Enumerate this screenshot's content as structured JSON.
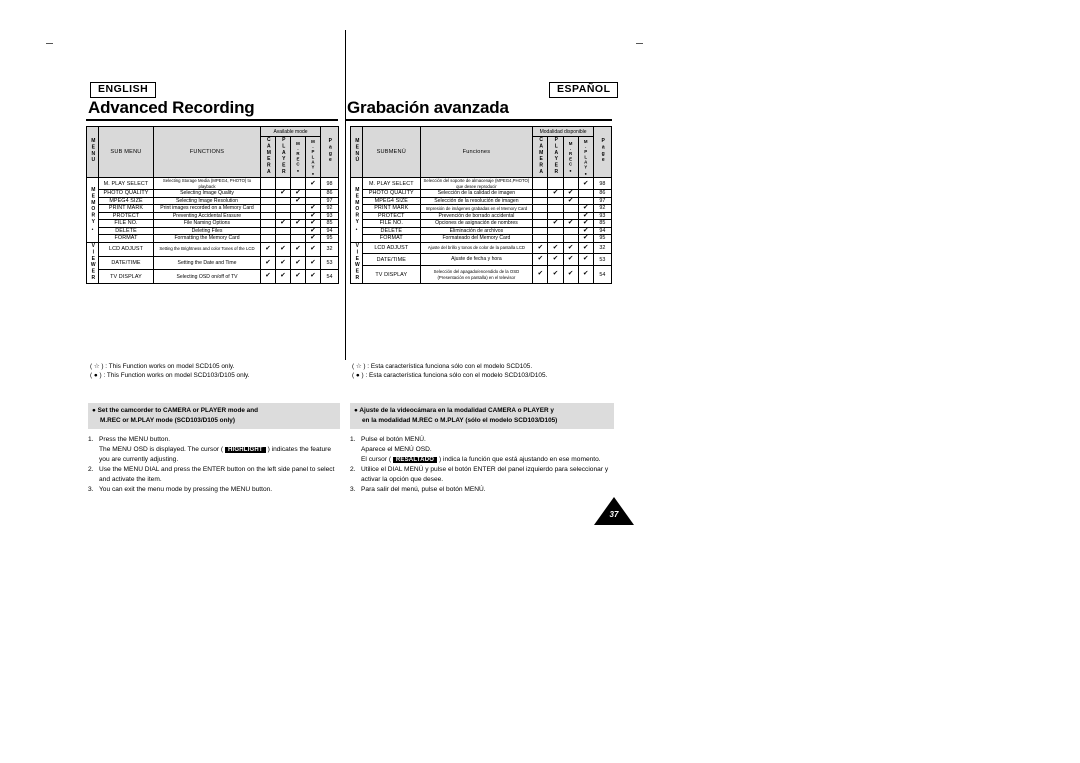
{
  "document": {
    "page_number": "37"
  },
  "english": {
    "language_badge": "ENGLISH",
    "heading": "Advanced Recording",
    "table": {
      "headers": {
        "menu": "MENU",
        "sub_menu": "SUB MENU",
        "functions": "FUNCTIONS",
        "available_mode": "Available mode",
        "camera": "CAMERA",
        "player": "PLAYER",
        "mrec": "M.REC",
        "mplay": "M.PLAY",
        "page": "Page"
      },
      "groups": [
        {
          "label": "MEMORY",
          "symbol": "•",
          "rows": [
            0,
            1,
            2,
            3,
            4,
            5,
            6,
            7
          ]
        },
        {
          "label": "VIEWER",
          "symbol": "",
          "rows": [
            8,
            9,
            10
          ]
        }
      ],
      "rows": [
        {
          "sub_menu": "M. PLAY SELECT",
          "function": "Selecting Storage Media (MPEG4, PHOTO) to playback",
          "camera": "",
          "player": "",
          "mrec": "",
          "mplay": "✔",
          "page": "98"
        },
        {
          "sub_menu": "PHOTO QUALITY",
          "function": "Selecting Image Quality",
          "camera": "",
          "player": "✔",
          "mrec": "✔",
          "mplay": "",
          "page": "86"
        },
        {
          "sub_menu": "MPEG4 SIZE",
          "function": "Selecting Image Resolution",
          "camera": "",
          "player": "",
          "mrec": "✔",
          "mplay": "",
          "page": "97"
        },
        {
          "sub_menu": "PRINT MARK",
          "function": "Print images recorded on a Memory Card",
          "camera": "",
          "player": "",
          "mrec": "",
          "mplay": "✔",
          "page": "92"
        },
        {
          "sub_menu": "PROTECT",
          "function": "Preventing Accidental Erasure",
          "camera": "",
          "player": "",
          "mrec": "",
          "mplay": "✔",
          "page": "93"
        },
        {
          "sub_menu": "FILE NO.",
          "function": "File Naming Options",
          "camera": "",
          "player": "✔",
          "mrec": "✔",
          "mplay": "✔",
          "page": "85"
        },
        {
          "sub_menu": "DELETE",
          "function": "Deleting Files",
          "camera": "",
          "player": "",
          "mrec": "",
          "mplay": "✔",
          "page": "94"
        },
        {
          "sub_menu": "FORMAT",
          "function": "Formatting the Memory Card",
          "camera": "",
          "player": "",
          "mrec": "",
          "mplay": "✔",
          "page": "95"
        },
        {
          "sub_menu": "LCD ADJUST",
          "function": "Setting the Brightness and color Tones of the LCD",
          "camera": "✔",
          "player": "✔",
          "mrec": "✔",
          "mplay": "✔",
          "page": "32"
        },
        {
          "sub_menu": "DATE/TIME",
          "function": "Setting the Date and Time",
          "camera": "✔",
          "player": "✔",
          "mrec": "✔",
          "mplay": "✔",
          "page": "53"
        },
        {
          "sub_menu": "TV DISPLAY",
          "function": "Selecting OSD on/off of TV",
          "camera": "✔",
          "player": "✔",
          "mrec": "✔",
          "mplay": "✔",
          "page": "54"
        }
      ]
    },
    "legend": [
      "( ☆ ) : This Function works on model SCD105 only.",
      "( ● ) : This Function works on model SCD103/D105 only."
    ],
    "callout": {
      "bullet": "●",
      "line1": "Set the camcorder to CAMERA or PLAYER mode and",
      "line2": "M.REC or M.PLAY mode (SCD103/D105 only)"
    },
    "steps": [
      {
        "num": "1.",
        "text_before": "Press the MENU button.\nThe MENU OSD is displayed. The cursor ( ",
        "highlight": "HIGHLIGHT",
        "text_after": " ) indicates the feature you are currently adjusting."
      },
      {
        "num": "2.",
        "text_before": "Use the MENU DIAL and press the ENTER button on the left side panel to select and activate the item.",
        "highlight": "",
        "text_after": ""
      },
      {
        "num": "3.",
        "text_before": "You can exit the menu mode by pressing the MENU button.",
        "highlight": "",
        "text_after": ""
      }
    ]
  },
  "spanish": {
    "language_badge": "ESPAÑOL",
    "heading": "Grabación avanzada",
    "table": {
      "headers": {
        "menu": "MENÚ",
        "sub_menu": "SUBMENÚ",
        "functions": "Funciones",
        "available_mode": "Modalidad disponible",
        "camera": "CAMERA",
        "player": "PLAYER",
        "mrec": "M.REC",
        "mplay": "M.PLAY",
        "page": "Page"
      },
      "groups": [
        {
          "label": "MEMORY",
          "symbol": "•",
          "rows": [
            0,
            1,
            2,
            3,
            4,
            5,
            6,
            7
          ]
        },
        {
          "label": "VIEWER",
          "symbol": "",
          "rows": [
            8,
            9,
            10
          ]
        }
      ],
      "rows": [
        {
          "sub_menu": "M. PLAY SELECT",
          "function": "Selección del soporte de almacenaje (MPEG4,PHOTO) que desee reproducir",
          "camera": "",
          "player": "",
          "mrec": "",
          "mplay": "✔",
          "page": "98"
        },
        {
          "sub_menu": "PHOTO QUALITY",
          "function": "Selección de la calidad de imagen",
          "camera": "",
          "player": "✔",
          "mrec": "✔",
          "mplay": "",
          "page": "86"
        },
        {
          "sub_menu": "MPEG4 SIZE",
          "function": "Selección de la resolución de imagen",
          "camera": "",
          "player": "",
          "mrec": "✔",
          "mplay": "",
          "page": "97"
        },
        {
          "sub_menu": "PRINT MARK",
          "function": "Impresión de imágenes grabadas en el Memory Card",
          "camera": "",
          "player": "",
          "mrec": "",
          "mplay": "✔",
          "page": "92"
        },
        {
          "sub_menu": "PROTECT",
          "function": "Prevención de borrado accidental",
          "camera": "",
          "player": "",
          "mrec": "",
          "mplay": "✔",
          "page": "93"
        },
        {
          "sub_menu": "FILE NO.",
          "function": "Opciones de asignación de nombres",
          "camera": "",
          "player": "✔",
          "mrec": "✔",
          "mplay": "✔",
          "page": "85"
        },
        {
          "sub_menu": "DELETE",
          "function": "Eliminación de archivos",
          "camera": "",
          "player": "",
          "mrec": "",
          "mplay": "✔",
          "page": "94"
        },
        {
          "sub_menu": "FORMAT",
          "function": "Formateado del Memory Card",
          "camera": "",
          "player": "",
          "mrec": "",
          "mplay": "✔",
          "page": "95"
        },
        {
          "sub_menu": "LCD ADJUST",
          "function": "Ajuste del brillo y tonos de color de la pantalla LCD",
          "camera": "✔",
          "player": "✔",
          "mrec": "✔",
          "mplay": "✔",
          "page": "32"
        },
        {
          "sub_menu": "DATE/TIME",
          "function": "Ajuste de fecha y hora",
          "camera": "✔",
          "player": "✔",
          "mrec": "✔",
          "mplay": "✔",
          "page": "53"
        },
        {
          "sub_menu": "TV DISPLAY",
          "function": "Selección del apagado/encendido de la OSD (Presentación en pantalla) en el televisor",
          "camera": "✔",
          "player": "✔",
          "mrec": "✔",
          "mplay": "✔",
          "page": "54"
        }
      ]
    },
    "legend": [
      "( ☆ ) : Esta característica funciona sólo con el modelo SCD105.",
      "( ● ) : Esta característica funciona sólo con el modelo SCD103/D105."
    ],
    "callout": {
      "bullet": "●",
      "line1": "Ajuste de la videocámara en la modalidad CAMERA o PLAYER y",
      "line2": "en la modalidad M.REC o M.PLAY (sólo el modelo SCD103/D105)"
    },
    "steps": [
      {
        "num": "1.",
        "text_before": "Pulse el botón MENÚ.\nAparece el MENÚ OSD.\nEl cursor ( ",
        "highlight": "RESALTADO",
        "text_after": " ) indica la función que está ajustando en ese momento."
      },
      {
        "num": "2.",
        "text_before": "Utilice el DIAL MENÚ y pulse el botón ENTER del panel izquierdo para seleccionar y activar la opción que desee.",
        "highlight": "",
        "text_after": ""
      },
      {
        "num": "3.",
        "text_before": "Para salir del menú, pulse el botón MENÚ.",
        "highlight": "",
        "text_after": ""
      }
    ]
  }
}
